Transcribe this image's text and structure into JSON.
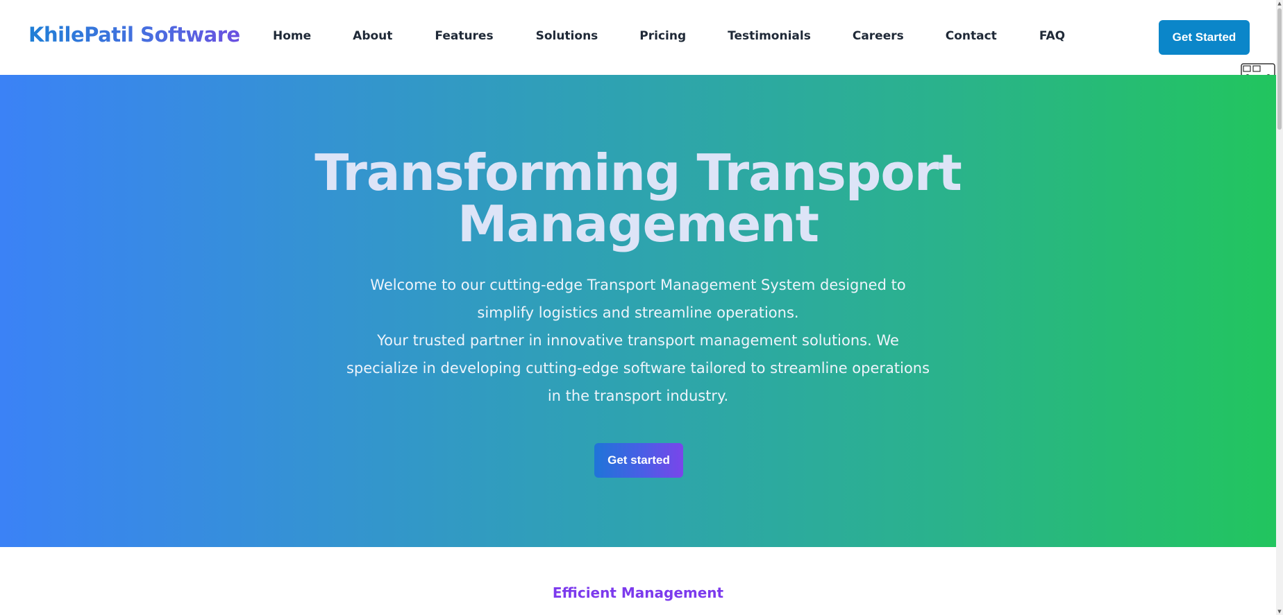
{
  "brand": {
    "name": "KhilePatil Software"
  },
  "nav": {
    "items": [
      {
        "label": "Home"
      },
      {
        "label": "About"
      },
      {
        "label": "Features"
      },
      {
        "label": "Solutions"
      },
      {
        "label": "Pricing"
      },
      {
        "label": "Testimonials"
      },
      {
        "label": "Careers"
      },
      {
        "label": "Contact"
      },
      {
        "label": "FAQ"
      }
    ],
    "cta_label": "Get Started"
  },
  "hero": {
    "title_line1": "Transforming Transport",
    "title_line2": "Management",
    "paragraph1": "Welcome to our cutting-edge Transport Management System designed to simplify logistics and streamline operations.",
    "paragraph2": "Your trusted partner in innovative transport management solutions. We specialize in developing cutting-edge software tailored to streamline operations in the transport industry.",
    "cta_label": "Get started"
  },
  "next_section": {
    "eyebrow": "Efficient Management"
  },
  "colors": {
    "hero_gradient_start": "#3b82f6",
    "hero_gradient_end": "#22c55e",
    "header_cta": "#0b86c9",
    "eyebrow": "#7c3aed"
  },
  "icons": {
    "corner_widget": "bus-icon",
    "scroll_up": "arrow-up-icon",
    "scroll_down": "arrow-down-icon"
  }
}
